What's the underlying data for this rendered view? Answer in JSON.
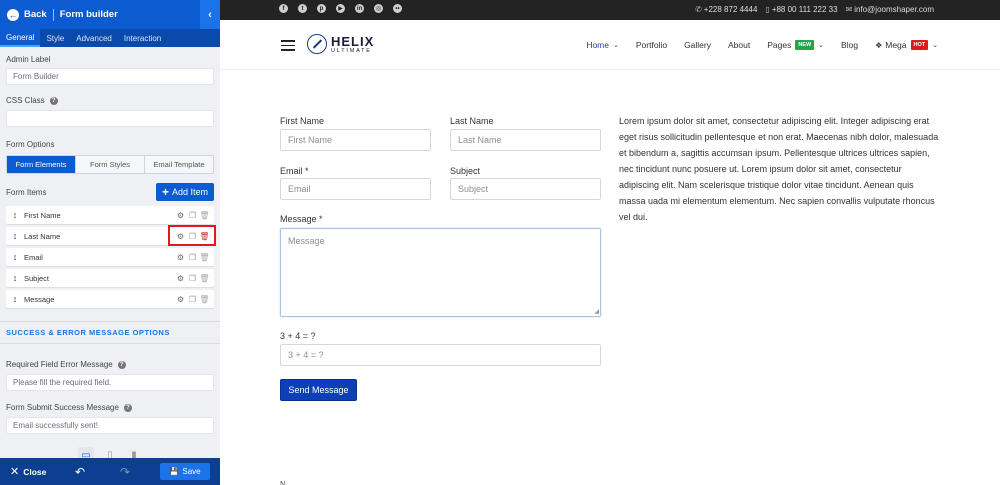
{
  "builder": {
    "back_label": "Back",
    "title": "Form builder",
    "tabs": [
      {
        "label": "General",
        "active": true
      },
      {
        "label": "Style",
        "active": false
      },
      {
        "label": "Advanced",
        "active": false
      },
      {
        "label": "Interaction",
        "active": false
      }
    ],
    "admin_label": {
      "label": "Admin Label",
      "value": "Form Builder"
    },
    "css_class": {
      "label": "CSS Class",
      "value": ""
    },
    "form_options": {
      "label": "Form Options",
      "segments": [
        {
          "label": "Form Elements",
          "active": true
        },
        {
          "label": "Form Styles",
          "active": false
        },
        {
          "label": "Email Template",
          "active": false
        }
      ]
    },
    "form_items": {
      "label": "Form Items",
      "add_label": "Add Item",
      "items": [
        {
          "label": "First Name"
        },
        {
          "label": "Last Name",
          "highlighted": true
        },
        {
          "label": "Email"
        },
        {
          "label": "Subject"
        },
        {
          "label": "Message"
        }
      ]
    },
    "section_title": "SUCCESS & ERROR MESSAGE OPTIONS",
    "required_error": {
      "label": "Required Field Error Message",
      "value": "Please fill the required field."
    },
    "success_message": {
      "label": "Form Submit Success Message",
      "value": "Email successfully sent!"
    },
    "footer": {
      "close_label": "Close",
      "save_label": "Save"
    }
  },
  "site": {
    "contact": {
      "phone": "+228 872 4444",
      "mobile": "+88 00 111 222 33",
      "email": "info@joomshaper.com"
    },
    "social_icons": [
      "facebook-icon",
      "twitter-icon",
      "pinterest-icon",
      "youtube-icon",
      "linkedin-icon",
      "instagram-icon",
      "flickr-icon"
    ],
    "logo": {
      "name": "HELIX",
      "sub": "ULTIMATE"
    },
    "menu": [
      {
        "label": "Home",
        "active": true,
        "dropdown": true
      },
      {
        "label": "Portfolio"
      },
      {
        "label": "Gallery"
      },
      {
        "label": "About"
      },
      {
        "label": "Pages",
        "badge": "NEW",
        "dropdown": true
      },
      {
        "label": "Blog"
      },
      {
        "label": "Mega",
        "badge": "HOT",
        "dropdown": true
      }
    ]
  },
  "form": {
    "first_name": {
      "label": "First Name",
      "placeholder": "First Name"
    },
    "last_name": {
      "label": "Last Name",
      "placeholder": "Last Name"
    },
    "email": {
      "label": "Email *",
      "placeholder": "Email"
    },
    "subject": {
      "label": "Subject",
      "placeholder": "Subject"
    },
    "message": {
      "label": "Message *",
      "placeholder": "Message"
    },
    "captcha": {
      "label": "3 + 4 = ?",
      "placeholder": "3 + 4 = ?"
    },
    "submit_label": "Send Message"
  },
  "lorem": "Lorem ipsum dolor sit amet, consectetur adipiscing elit. Integer adipiscing erat eget risus sollicitudin pellentesque et non erat. Maecenas nibh dolor, malesuada et bibendum a, sagittis accumsan ipsum. Pellentesque ultrices ultrices sapien, nec tincidunt nunc posuere ut. Lorem ipsum dolor sit amet, consectetur adipiscing elit. Nam scelerisque tristique dolor vitae tincidunt. Aenean quis massa uada mi elementum elementum. Nec sapien convallis vulputate rhoncus vel dui.",
  "next_hint": "N"
}
